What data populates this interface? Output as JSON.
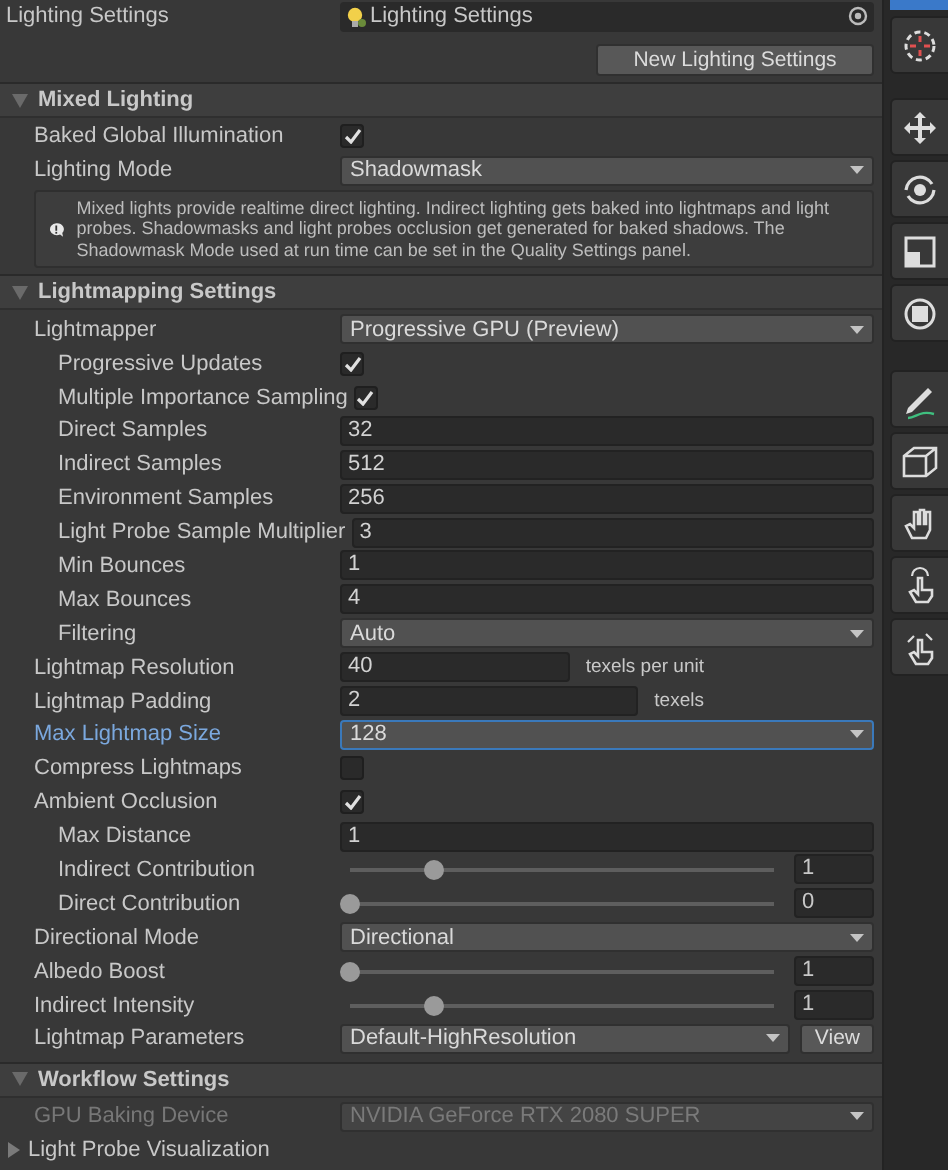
{
  "asset": {
    "label": "Lighting Settings",
    "value": "Lighting Settings",
    "button": "New Lighting Settings"
  },
  "sections": [
    {
      "title": "Mixed Lighting",
      "expanded": true,
      "rows": [
        {
          "kind": "checkbox",
          "label": "Baked Global Illumination",
          "checked": true
        },
        {
          "kind": "dropdown",
          "label": "Lighting Mode",
          "value": "Shadowmask"
        },
        {
          "kind": "info",
          "text": "Mixed lights provide realtime direct lighting. Indirect lighting gets baked into lightmaps and light probes. Shadowmasks and light probes occlusion get generated for baked shadows. The Shadowmask Mode used at run time can be set in the Quality Settings panel."
        }
      ]
    },
    {
      "title": "Lightmapping Settings",
      "expanded": true,
      "rows": [
        {
          "kind": "dropdown",
          "label": "Lightmapper",
          "value": "Progressive GPU (Preview)",
          "children": [
            {
              "kind": "checkbox",
              "label": "Progressive Updates",
              "checked": true
            },
            {
              "kind": "checkbox",
              "label": "Multiple Importance Sampling",
              "checked": true
            },
            {
              "kind": "field",
              "label": "Direct Samples",
              "value": "32"
            },
            {
              "kind": "field",
              "label": "Indirect Samples",
              "value": "512"
            },
            {
              "kind": "field",
              "label": "Environment Samples",
              "value": "256"
            },
            {
              "kind": "field",
              "label": "Light Probe Sample Multiplier",
              "value": "3"
            },
            {
              "kind": "field",
              "label": "Min Bounces",
              "value": "1"
            },
            {
              "kind": "field",
              "label": "Max Bounces",
              "value": "4"
            },
            {
              "kind": "dropdown",
              "label": "Filtering",
              "value": "Auto"
            }
          ]
        },
        {
          "kind": "field",
          "label": "Lightmap Resolution",
          "value": "40",
          "unit": "texels per unit"
        },
        {
          "kind": "field",
          "label": "Lightmap Padding",
          "value": "2",
          "unit": "texels"
        },
        {
          "kind": "dropdown",
          "label": "Max Lightmap Size",
          "value": "128",
          "focused": true
        },
        {
          "kind": "checkbox",
          "label": "Compress Lightmaps",
          "checked": false
        },
        {
          "kind": "checkbox",
          "label": "Ambient Occlusion",
          "checked": true,
          "children": [
            {
              "kind": "field",
              "label": "Max Distance",
              "value": "1"
            },
            {
              "kind": "slider",
              "label": "Indirect Contribution",
              "level": 0.2,
              "value": "1"
            },
            {
              "kind": "slider",
              "label": "Direct Contribution",
              "level": 0,
              "value": "0"
            }
          ]
        },
        {
          "kind": "dropdown",
          "label": "Directional Mode",
          "value": "Directional"
        },
        {
          "kind": "slider",
          "label": "Albedo Boost",
          "level": 0,
          "value": "1"
        },
        {
          "kind": "slider",
          "label": "Indirect Intensity",
          "level": 0.2,
          "value": "1"
        },
        {
          "kind": "dropdown",
          "label": "Lightmap Parameters",
          "value": "Default-HighResolution",
          "button": "View"
        }
      ]
    },
    {
      "title": "Workflow Settings",
      "expanded": true,
      "rows": [
        {
          "kind": "dropdown",
          "label": "GPU Baking Device",
          "value": "NVIDIA GeForce RTX 2080 SUPER",
          "disabled": true
        },
        {
          "kind": "foldout",
          "label": "Light Probe Visualization",
          "expanded": false
        }
      ]
    }
  ]
}
